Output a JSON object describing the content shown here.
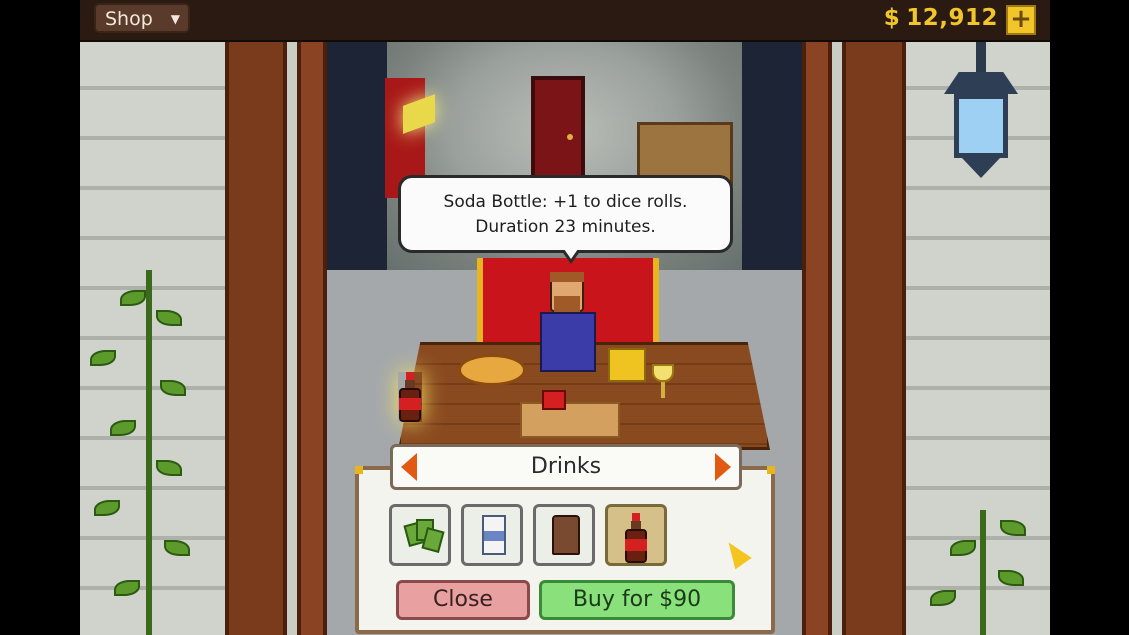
{
  "topbar": {
    "menu_label": "Shop",
    "currency_symbol": "$",
    "money": "12,912",
    "add_money_symbol": "+"
  },
  "speech": {
    "line1": "Soda Bottle:  +1 to dice rolls.",
    "line2": "Duration 23 minutes."
  },
  "shop": {
    "category": "Drinks",
    "items": [
      {
        "icon": "cards-icon",
        "selected": false
      },
      {
        "icon": "milk-carton-icon",
        "selected": false
      },
      {
        "icon": "coffee-icon",
        "selected": false
      },
      {
        "icon": "soda-bottle-icon",
        "selected": true
      }
    ],
    "close_label": "Close",
    "buy_label": "Buy for $90"
  },
  "colors": {
    "money": "#f2c52a",
    "arrow": "#e05a14",
    "close": "#e8a0a0",
    "buy": "#8ae07a",
    "carpet": "#c8141a"
  }
}
